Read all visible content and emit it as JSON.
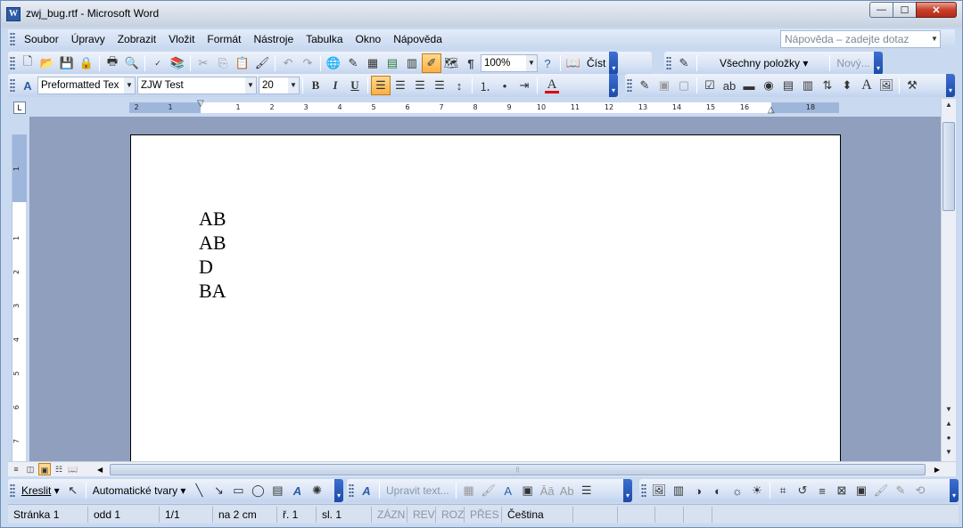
{
  "window": {
    "title": "zwj_bug.rtf - Microsoft Word",
    "app_icon": "W",
    "close_glyph": "✕",
    "minimize_glyph": "—",
    "maximize_glyph": "☐"
  },
  "menu": {
    "items": [
      "Soubor",
      "Úpravy",
      "Zobrazit",
      "Vložit",
      "Formát",
      "Nástroje",
      "Tabulka",
      "Okno",
      "Nápověda"
    ],
    "help_placeholder": "Nápověda – zadejte dotaz"
  },
  "standard_toolbar": {
    "zoom": "100%",
    "read_label": "Číst",
    "all_items_label": "Všechny položky",
    "new_label": "Nový..."
  },
  "formatting_toolbar": {
    "style": "Preformatted Tex",
    "font": "ZJW Test",
    "size": "20",
    "bold": "B",
    "italic": "I",
    "underline": "U",
    "font_color_letter": "A"
  },
  "ruler": {
    "tab_glyph": "L",
    "numbers": [
      "2",
      "1",
      "1",
      "2",
      "3",
      "4",
      "5",
      "6",
      "7",
      "8",
      "9",
      "10",
      "11",
      "12",
      "13",
      "14",
      "15",
      "16",
      "17",
      "18"
    ],
    "vertical_numbers": [
      "1",
      "1",
      "2",
      "3",
      "4",
      "5",
      "6",
      "7"
    ]
  },
  "document": {
    "lines": [
      "AB",
      "AB",
      "D",
      "BA"
    ]
  },
  "drawing_toolbar": {
    "draw_label": "Kreslit",
    "autoshapes_label": "Automatické tvary",
    "edit_text_label": "Upravit text..."
  },
  "status": {
    "page": "Stránka  1",
    "section": "odd  1",
    "pages": "1/1",
    "position": "na  2 cm",
    "line": "ř.  1",
    "column": "sl.  1",
    "rec": "ZÁZN",
    "trk": "REV",
    "ext": "ROZ",
    "ovr": "PŘES",
    "language": "Čeština"
  }
}
